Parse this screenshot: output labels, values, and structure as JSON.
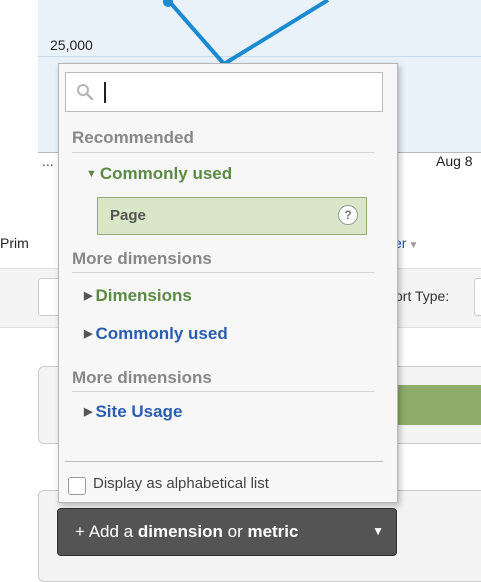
{
  "background": {
    "chart": {
      "y_tick_label": "25,000",
      "x_ellipsis": "...",
      "x_tick_label": "Aug 8",
      "line_color": "#1b8ad1"
    },
    "primary_dimension_text": "Prim",
    "other_link": {
      "text": "er",
      "caret": "▼"
    },
    "sort_type_label": "ort Type:"
  },
  "picker": {
    "search": {
      "value": "",
      "placeholder": ""
    },
    "sections": [
      {
        "header": "Recommended"
      },
      {
        "header": "More dimensions"
      },
      {
        "header": "More dimensions"
      }
    ],
    "groups": {
      "commonly_used_expanded": {
        "arrow": "▼",
        "label": "Commonly used"
      },
      "dimensions": {
        "arrow": "▶",
        "label": "Dimensions"
      },
      "commonly_used": {
        "arrow": "▶",
        "label": "Commonly used"
      },
      "site_usage": {
        "arrow": "▶",
        "label": "Site Usage"
      }
    },
    "selected_item": {
      "label": "Page",
      "help": "?"
    },
    "alphabetical": {
      "label": "Display as alphabetical list",
      "checked": false
    }
  },
  "add_button": {
    "prefix": "+ Add a ",
    "bold1": "dimension",
    "middle": " or ",
    "bold2": "metric",
    "caret": "▼"
  },
  "colors": {
    "green_label": "#5b8a44",
    "blue_label": "#2a5db0",
    "selected_bg": "#d9e6c8",
    "button_bg": "#545454"
  }
}
